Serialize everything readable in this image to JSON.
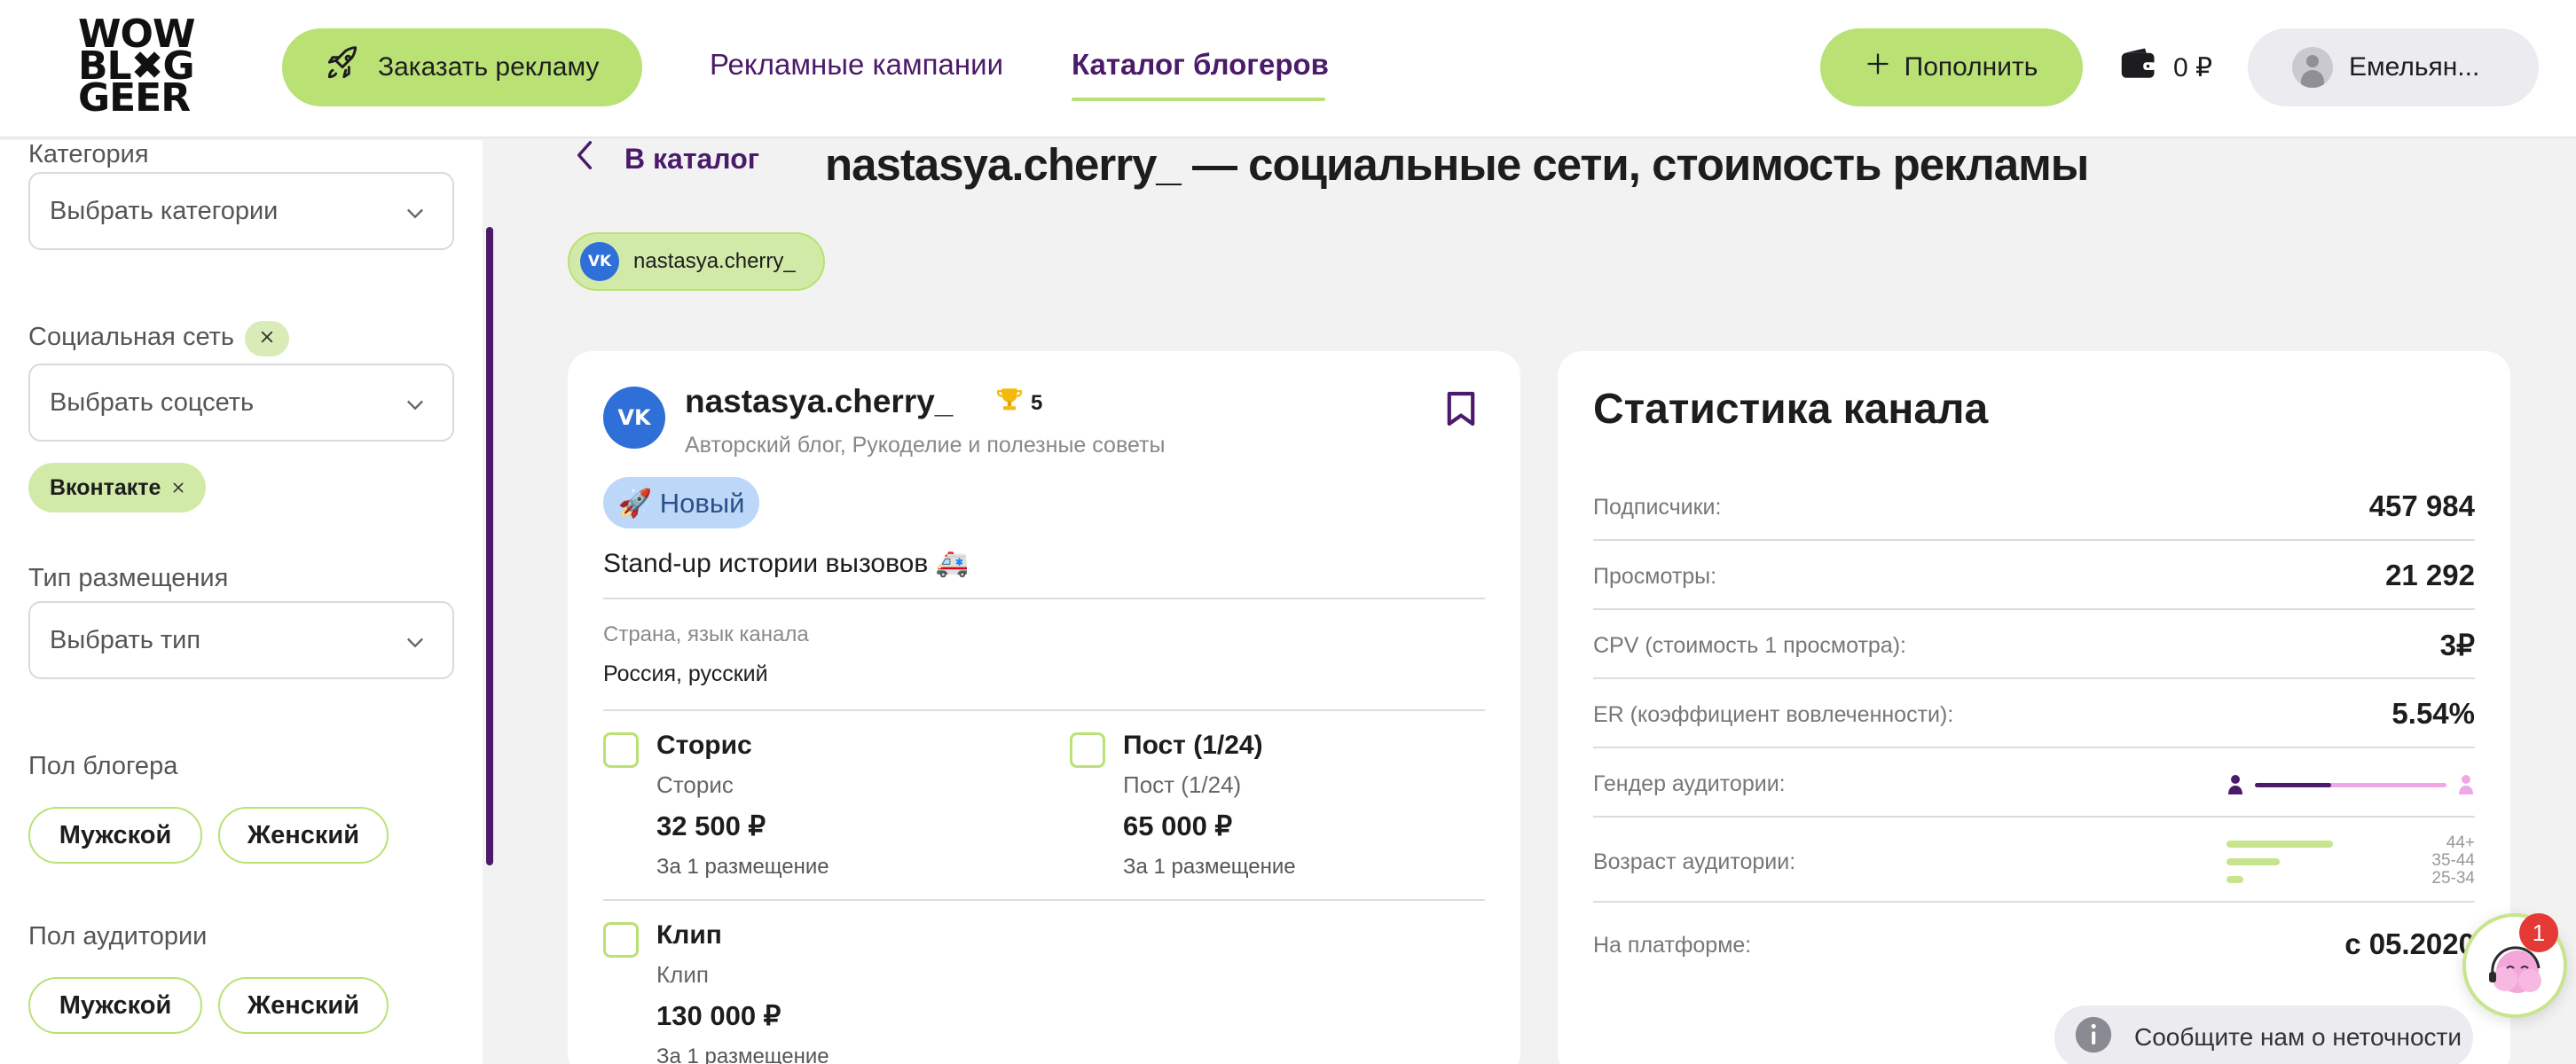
{
  "header": {
    "logo_lines": [
      "WOW",
      "BL✖G",
      "GEER"
    ],
    "order_label": "Заказать рекламу",
    "nav": [
      {
        "label": "Рекламные кампании",
        "active": false
      },
      {
        "label": "Каталог блогеров",
        "active": true
      }
    ],
    "topup_label": "Пополнить",
    "balance": "0 ₽",
    "user_name": "Емельян..."
  },
  "sidebar": {
    "category_label": "Категория",
    "category_placeholder": "Выбрать категории",
    "social_label": "Социальная сеть",
    "social_placeholder": "Выбрать соцсеть",
    "social_chip": "Вконтакте",
    "placement_label": "Тип размещения",
    "placement_placeholder": "Выбрать тип",
    "blogger_gender_label": "Пол блогера",
    "audience_gender_label": "Пол аудитории",
    "gender_male": "Мужской",
    "gender_female": "Женский"
  },
  "main": {
    "back_label": "В каталог",
    "title": "nastasya.cherry_ — социальные сети, стоимость рекламы",
    "social_chip": "nastasya.cherry_",
    "vk_glyph": "VK"
  },
  "profile": {
    "name": "nastasya.cherry_",
    "rating": "5",
    "categories": "Авторский блог, Рукоделие и полезные советы",
    "badge": "🚀 Новый",
    "description": "Stand-up истории вызовов 🚑",
    "country_label": "Страна, язык канала",
    "country_value": "Россия, русский",
    "offers": [
      {
        "title": "Сторис",
        "subtitle": "Сторис",
        "price": "32 500 ₽",
        "per": "За 1 размещение"
      },
      {
        "title": "Пост (1/24)",
        "subtitle": "Пост (1/24)",
        "price": "65 000 ₽",
        "per": "За 1 размещение"
      },
      {
        "title": "Клип",
        "subtitle": "Клип",
        "price": "130 000 ₽",
        "per": "За 1 размещение"
      }
    ]
  },
  "stats": {
    "title": "Статистика канала",
    "subscribers_label": "Подписчики:",
    "subscribers_value": "457 984",
    "views_label": "Просмотры:",
    "views_value": "21 292",
    "cpv_label": "CPV (стоимость 1 просмотра):",
    "cpv_value": "3₽",
    "er_label": "ER (коэффициент вовлеченности):",
    "er_value": "5.54%",
    "gender_label": "Гендер аудитории:",
    "gender_male_share": 0.4,
    "age_label": "Возраст аудитории:",
    "age_groups": [
      {
        "label": "44+",
        "share": 0.5
      },
      {
        "label": "35-44",
        "share": 0.25
      },
      {
        "label": "25-34",
        "share": 0.08
      }
    ],
    "platform_label": "На платформе:",
    "platform_value": "с 05.2020",
    "report_label": "Сообщите нам о неточности"
  },
  "chat": {
    "unread": "1"
  },
  "colors": {
    "accent_green": "#b9e174",
    "brand_purple": "#4b1a6a",
    "vk_blue": "#2e6fd8",
    "female_pink": "#f0a7e6"
  }
}
